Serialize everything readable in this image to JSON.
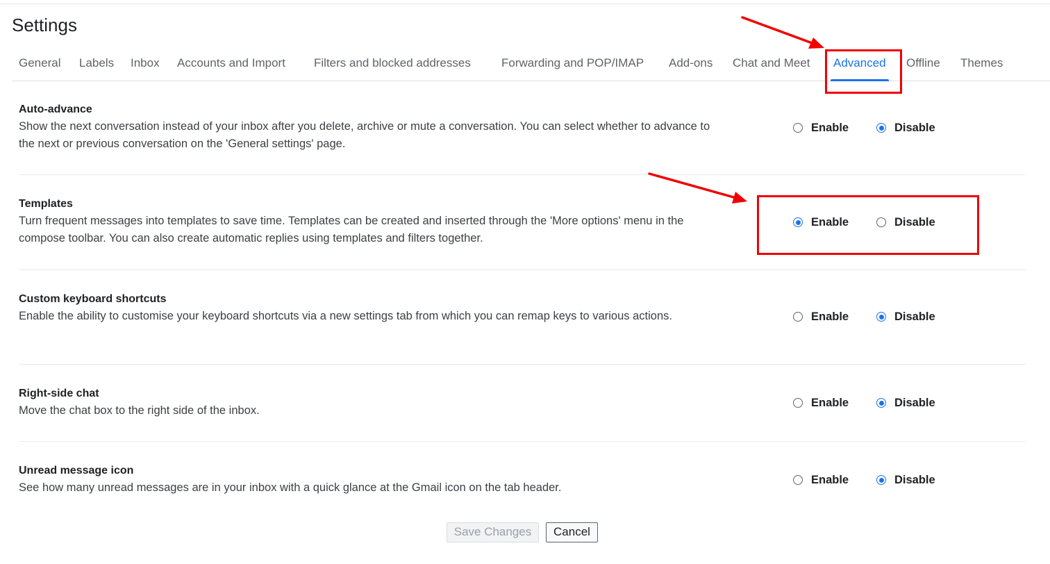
{
  "page_title": "Settings",
  "tabs": [
    {
      "label": "General",
      "active": false
    },
    {
      "label": "Labels",
      "active": false
    },
    {
      "label": "Inbox",
      "active": false
    },
    {
      "label": "Accounts and Import",
      "active": false
    },
    {
      "label": "Filters and blocked addresses",
      "active": false
    },
    {
      "label": "Forwarding and POP/IMAP",
      "active": false
    },
    {
      "label": "Add-ons",
      "active": false
    },
    {
      "label": "Chat and Meet",
      "active": false
    },
    {
      "label": "Advanced",
      "active": true
    },
    {
      "label": "Offline",
      "active": false
    },
    {
      "label": "Themes",
      "active": false
    }
  ],
  "settings": [
    {
      "title": "Auto-advance",
      "description": "Show the next conversation instead of your inbox after you delete, archive or mute a conversation. You can select whether to advance to the next or previous conversation on the 'General settings' page.",
      "enable_label": "Enable",
      "disable_label": "Disable",
      "selected": "disable"
    },
    {
      "title": "Templates",
      "description": "Turn frequent messages into templates to save time. Templates can be created and inserted through the 'More options' menu in the compose toolbar. You can also create automatic replies using templates and filters together.",
      "enable_label": "Enable",
      "disable_label": "Disable",
      "selected": "enable"
    },
    {
      "title": "Custom keyboard shortcuts",
      "description": "Enable the ability to customise your keyboard shortcuts via a new settings tab from which you can remap keys to various actions.",
      "enable_label": "Enable",
      "disable_label": "Disable",
      "selected": "disable"
    },
    {
      "title": "Right-side chat",
      "description": "Move the chat box to the right side of the inbox.",
      "enable_label": "Enable",
      "disable_label": "Disable",
      "selected": "disable"
    },
    {
      "title": "Unread message icon",
      "description": "See how many unread messages are in your inbox with a quick glance at the Gmail icon on the tab header.",
      "enable_label": "Enable",
      "disable_label": "Disable",
      "selected": "disable"
    }
  ],
  "buttons": {
    "save_label": "Save Changes",
    "cancel_label": "Cancel"
  },
  "colors": {
    "accent": "#1a73e8",
    "annotation": "#f00000"
  }
}
